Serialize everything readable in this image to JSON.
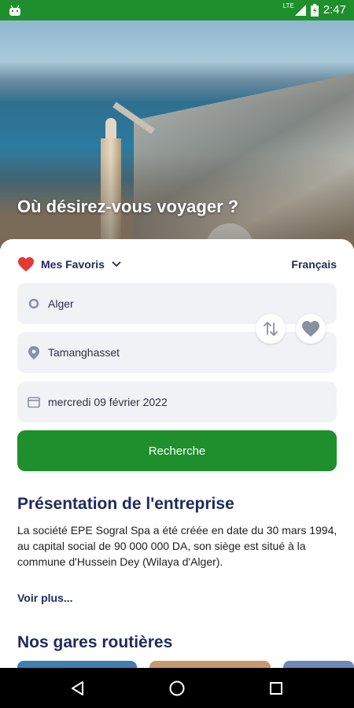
{
  "statusbar": {
    "time": "2:47",
    "network": "LTE",
    "icons": [
      "android-icon",
      "lte-signal-icon",
      "battery-icon"
    ]
  },
  "hero": {
    "title": "Où désirez-vous voyager ?"
  },
  "favorites": {
    "label": "Mes Favoris",
    "icon": "heart-icon",
    "heart_color": "#e53935"
  },
  "language": {
    "label": "Français"
  },
  "search_form": {
    "origin": "Alger",
    "destination": "Tamanghasset",
    "date": "mercredi 09 février 2022",
    "button": "Recherche"
  },
  "company": {
    "title": "Présentation de l'entreprise",
    "text": "La société EPE Sogral Spa a été créée en date du 30 mars 1994, au capital social de 90 000 000 DA, son siège est situé à la commune d'Hussein Dey (Wilaya d'Alger).",
    "more": "Voir plus..."
  },
  "stations": {
    "title": "Nos gares routières"
  },
  "colors": {
    "brand_green": "#1e8f2c",
    "navy": "#1f2a5c"
  },
  "navbar": {
    "buttons": [
      "back-icon",
      "home-icon",
      "recents-icon"
    ]
  }
}
